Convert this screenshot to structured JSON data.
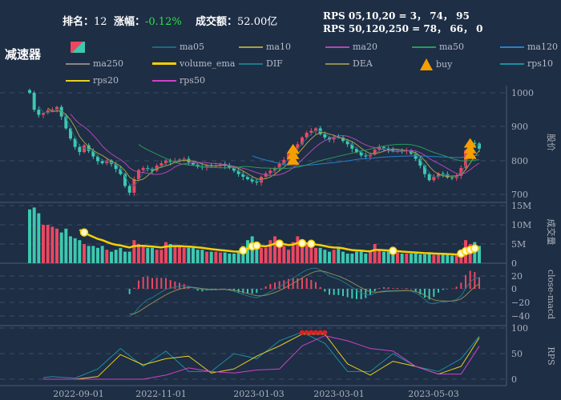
{
  "header": {
    "rank_label": "排名：",
    "rank": "12",
    "change_label": "涨幅：",
    "change": "-0.12%",
    "amount_label": "成交额：",
    "amount": "52.00亿",
    "rps_line1": "RPS 05,10,20 = 3， 74， 95",
    "rps_line2": "RPS 50,120,250 = 78， 66， 0"
  },
  "stock_name": "减速器",
  "colors": {
    "up": "#ec4760",
    "down": "#3cc9b0",
    "ma05": "#1c6a80",
    "ma10": "#a8a040",
    "ma20": "#b048b0",
    "ma50": "#2a9a5c",
    "ma120": "#2a7fc8",
    "ma250": "#888",
    "volume_ema": "#f5d000",
    "DIF": "#1c7a88",
    "DEA": "#908a50",
    "buy": "#f5a000",
    "rps10": "#1b8fa0",
    "rps20": "#e8d020",
    "rps50": "#d040c8"
  },
  "legend": [
    {
      "key": "candle",
      "label": ""
    },
    {
      "key": "ma05",
      "label": "ma05"
    },
    {
      "key": "ma10",
      "label": "ma10"
    },
    {
      "key": "ma20",
      "label": "ma20"
    },
    {
      "key": "ma50",
      "label": "ma50"
    },
    {
      "key": "ma120",
      "label": "ma120"
    },
    {
      "key": "ma250",
      "label": "ma250"
    },
    {
      "key": "volume_ema",
      "label": "volume_ema"
    },
    {
      "key": "DIF",
      "label": "DIF"
    },
    {
      "key": "DEA",
      "label": "DEA"
    },
    {
      "key": "buy",
      "label": "buy"
    },
    {
      "key": "rps10",
      "label": "rps10"
    },
    {
      "key": "rps20",
      "label": "rps20"
    },
    {
      "key": "rps50",
      "label": "rps50"
    }
  ],
  "axes": {
    "price_title": "股价",
    "volume_title": "成交量",
    "macd_title": "close-macd",
    "rps_title": "RPS",
    "price_ticks": [
      "1000",
      "900",
      "800",
      "700"
    ],
    "volume_ticks": [
      "15M",
      "10M",
      "5M",
      "0"
    ],
    "macd_ticks": [
      "20",
      "0",
      "−20",
      "−40"
    ],
    "rps_ticks": [
      "100",
      "50",
      "0"
    ],
    "x_ticks": [
      "2022-09-01",
      "2022-11-01",
      "2023-01-03",
      "2023-03-01",
      "2023-05-03"
    ]
  },
  "chart_data": {
    "close": [
      1000,
      950,
      935,
      940,
      948,
      950,
      958,
      930,
      895,
      865,
      840,
      825,
      845,
      828,
      812,
      798,
      792,
      800,
      790,
      775,
      760,
      725,
      705,
      745,
      772,
      778,
      776,
      770,
      785,
      792,
      800,
      796,
      800,
      803,
      805,
      795,
      788,
      782,
      780,
      786,
      784,
      786,
      790,
      785,
      778,
      770,
      760,
      752,
      745,
      738,
      735,
      752,
      762,
      770,
      778,
      790,
      802,
      820,
      835,
      848,
      868,
      882,
      888,
      895,
      878,
      868,
      862,
      870,
      868,
      858,
      848,
      835,
      825,
      815,
      812,
      818,
      832,
      840,
      836,
      832,
      828,
      830,
      828,
      830,
      820,
      805,
      785,
      760,
      742,
      752,
      762,
      760,
      750,
      748,
      755,
      778,
      830,
      852,
      850,
      835
    ],
    "volume_m": [
      14,
      14.5,
      13,
      10,
      10,
      9.5,
      9,
      8,
      9,
      7,
      6.5,
      6,
      5,
      4.5,
      4.5,
      4,
      4.5,
      3.5,
      3,
      3.5,
      4,
      3,
      3,
      6,
      5,
      4.5,
      4,
      4,
      3.5,
      3.5,
      5.5,
      5,
      4.5,
      4.5,
      4,
      4,
      4,
      3.5,
      3.5,
      3,
      3,
      3,
      2.8,
      2.8,
      2.5,
      2.5,
      3,
      4.5,
      6,
      7,
      5.5,
      4,
      4,
      6,
      7,
      5,
      4.5,
      3.5,
      5.5,
      7,
      5,
      5,
      4.5,
      4,
      4,
      3.5,
      3,
      3.5,
      4,
      3,
      2.5,
      2.5,
      3,
      3,
      2.5,
      3,
      5,
      3.5,
      3,
      3,
      2.8,
      2.8,
      2.5,
      2.5,
      2.5,
      2.5,
      2.3,
      2.3,
      2.5,
      2.2,
      2.2,
      2.3,
      2.2,
      2,
      2,
      3.5,
      6,
      5,
      5.5,
      4.5
    ],
    "rps_step": 5,
    "rps10": [
      0,
      5,
      2,
      20,
      60,
      25,
      55,
      15,
      15,
      50,
      40,
      75,
      92,
      70,
      15,
      15,
      50,
      25,
      15,
      40,
      95
    ],
    "rps20": [
      0,
      0,
      0,
      5,
      48,
      28,
      40,
      45,
      12,
      20,
      45,
      65,
      88,
      88,
      30,
      8,
      35,
      25,
      10,
      25,
      95
    ],
    "rps50": [
      0,
      0,
      0,
      0,
      0,
      0,
      8,
      22,
      15,
      12,
      18,
      20,
      65,
      85,
      75,
      60,
      55,
      25,
      10,
      10,
      78
    ],
    "buy_bars": [
      58,
      97
    ],
    "volume_highlight_bars": [
      12,
      47,
      49,
      50,
      55,
      60,
      62,
      80,
      95,
      96,
      97,
      98
    ]
  }
}
